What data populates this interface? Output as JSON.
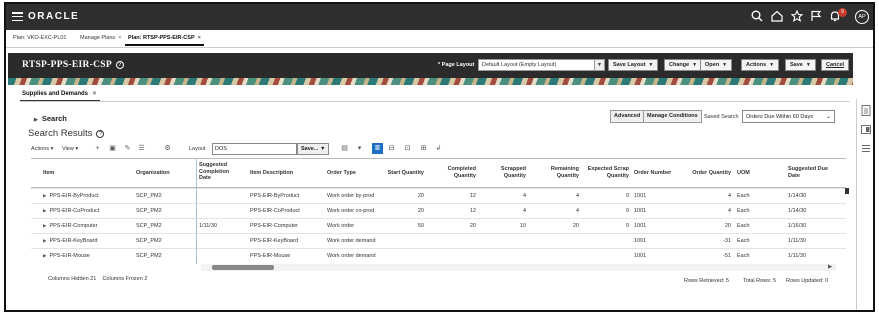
{
  "app": {
    "brand": "ORACLE",
    "avatar_initials": "AP",
    "notification_count": "9"
  },
  "tabs": [
    {
      "label": "Plan: VKO-EXC-PL01",
      "closable": false
    },
    {
      "label": "Manage Plans",
      "closable": true
    },
    {
      "label": "Plan: RTSP-PPS-EIR-CSP",
      "closable": true,
      "active": true
    }
  ],
  "tab_close_glyph": "×",
  "header": {
    "title": "RTSP-PPS-EIR-CSP",
    "help_glyph": "?",
    "page_layout_label": "* Page Layout",
    "page_layout_value": "Default Layout (Empty Layout)",
    "buttons": {
      "save_layout": "Save Layout",
      "change": "Change",
      "open": "Open",
      "actions": "Actions",
      "save": "Save",
      "cancel": "Cancel"
    }
  },
  "content_tab": {
    "label": "Supplies and Demands",
    "close": "×"
  },
  "search": {
    "title": "Search",
    "advanced": "Advanced",
    "manage_conditions": "Manage Conditions",
    "saved_search_label": "Saved Search",
    "saved_search_value": "Orders Due Within 60 Days"
  },
  "results": {
    "title": "Search Results",
    "toolbar": {
      "actions": "Actions",
      "view": "View",
      "layout_label": "Layout",
      "layout_value": "DOS",
      "save": "Save..."
    },
    "columns": [
      "Item",
      "Organization",
      "Suggested Completion Date",
      "Item Description",
      "Order Type",
      "Start Quantity",
      "Completed Quantity",
      "Scrapped Quantity",
      "Remaining Quantity",
      "Expected Scrap Quantity",
      "Order Number",
      "Order Quantity",
      "UOM",
      "Suggested Due Date"
    ],
    "rows": [
      {
        "item": "PPS-EIR-ByProduct",
        "org": "SCP_PM2",
        "completion": "",
        "desc": "PPS-EIR-ByProduct",
        "type": "Work order by-prod",
        "start": "20",
        "completed": "12",
        "scrapped": "4",
        "remaining": "4",
        "exp_scrap": "0",
        "order_no": "1001",
        "order_qty": "4",
        "uom": "Each",
        "due": "1/14/30"
      },
      {
        "item": "PPS-EIR-CoProduct",
        "org": "SCP_PM2",
        "completion": "",
        "desc": "PPS-EIR-CoProduct",
        "type": "Work order co-prod",
        "start": "20",
        "completed": "12",
        "scrapped": "4",
        "remaining": "4",
        "exp_scrap": "0",
        "order_no": "1001",
        "order_qty": "4",
        "uom": "Each",
        "due": "1/14/30"
      },
      {
        "item": "PPS-EIR-Computer",
        "org": "SCP_PM2",
        "completion": "1/11/30",
        "desc": "PPS-EIR-Computer",
        "type": "Work order",
        "start": "50",
        "completed": "20",
        "scrapped": "10",
        "remaining": "20",
        "exp_scrap": "0",
        "order_no": "1001",
        "order_qty": "20",
        "uom": "Each",
        "due": "1/16/30"
      },
      {
        "item": "PPS-EIR-KeyBoard",
        "org": "SCP_PM2",
        "completion": "",
        "desc": "PPS-EIR-KeyBoard",
        "type": "Work order demand",
        "start": "",
        "completed": "",
        "scrapped": "",
        "remaining": "",
        "exp_scrap": "",
        "order_no": "1001",
        "order_qty": "-31",
        "uom": "Each",
        "due": "1/11/30"
      },
      {
        "item": "PPS-EIR-Mouse",
        "org": "SCP_PM2",
        "completion": "",
        "desc": "PPS-EIR-Mouse",
        "type": "Work order demand",
        "start": "",
        "completed": "",
        "scrapped": "",
        "remaining": "",
        "exp_scrap": "",
        "order_no": "1001",
        "order_qty": "-51",
        "uom": "Each",
        "due": "1/11/30"
      }
    ],
    "footer": {
      "columns_hidden": "Columns Hidden 21",
      "columns_frozen": "Columns Frozen 2",
      "rows_retrieved": "Rows Retrieved: 5",
      "total_rows": "Total Rows: 5",
      "rows_updated": "Rows Updated: 0"
    }
  },
  "colors": {
    "topbar": "#2f2f2f",
    "banner": "#2b2b2b",
    "accent_blue": "#1d6fc4",
    "notification": "#c73b2c"
  },
  "icons": [
    "hamburger-icon",
    "search-icon",
    "home-icon",
    "star-icon",
    "flag-icon",
    "bell-icon",
    "add-icon",
    "edit-icon",
    "freeze-icon",
    "detach-icon",
    "wrap-icon"
  ]
}
